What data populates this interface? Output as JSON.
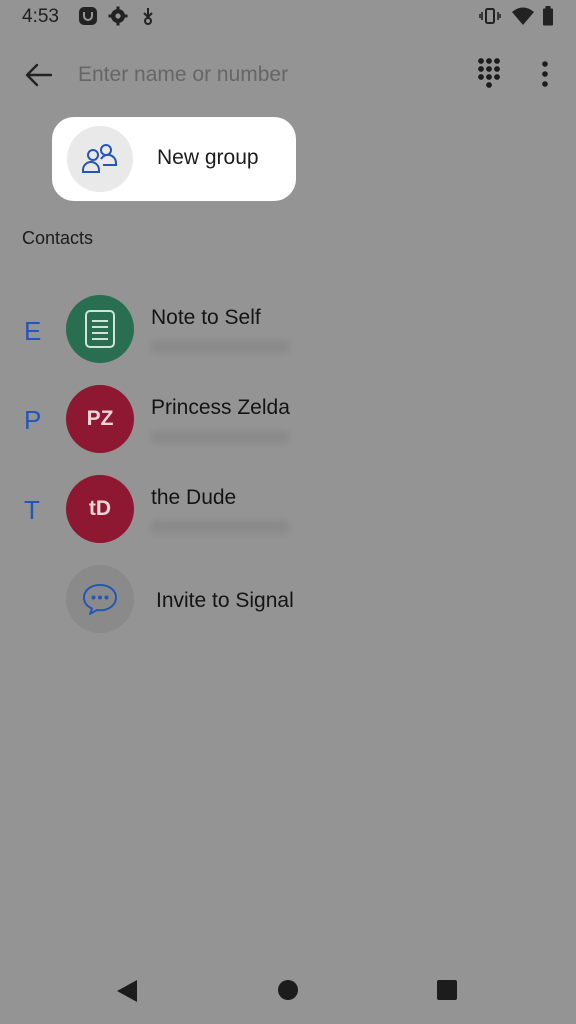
{
  "status_bar": {
    "time": "4:53",
    "left_icons": [
      "signal-app-icon",
      "settings-gear-icon",
      "download-icon"
    ],
    "right_icons": [
      "vibrate-icon",
      "wifi-icon",
      "battery-icon"
    ]
  },
  "toolbar": {
    "back_icon": "arrow-left-icon",
    "search_placeholder": "Enter name or number",
    "search_value": "",
    "dialpad_icon": "dialpad-icon",
    "more_icon": "more-vertical-icon"
  },
  "new_group": {
    "label": "New group",
    "icon": "group-people-icon"
  },
  "contacts": {
    "header": "Contacts",
    "items": [
      {
        "letter": "E",
        "initials": "",
        "name": "Note to Self",
        "avatar_color": "#2a6e52",
        "icon": "note-icon"
      },
      {
        "letter": "P",
        "initials": "PZ",
        "name": "Princess Zelda",
        "avatar_color": "#8e1731"
      },
      {
        "letter": "T",
        "initials": "tD",
        "name": "the Dude",
        "avatar_color": "#8e1731"
      }
    ],
    "invite": {
      "label": "Invite to Signal",
      "icon": "chat-bubble-icon"
    }
  },
  "nav_bar": {
    "back": "triangle-back-icon",
    "home": "circle-home-icon",
    "recents": "square-recents-icon"
  },
  "colors": {
    "background": "#949494",
    "accent": "#2456b8",
    "spotlight": "#ffffff"
  }
}
